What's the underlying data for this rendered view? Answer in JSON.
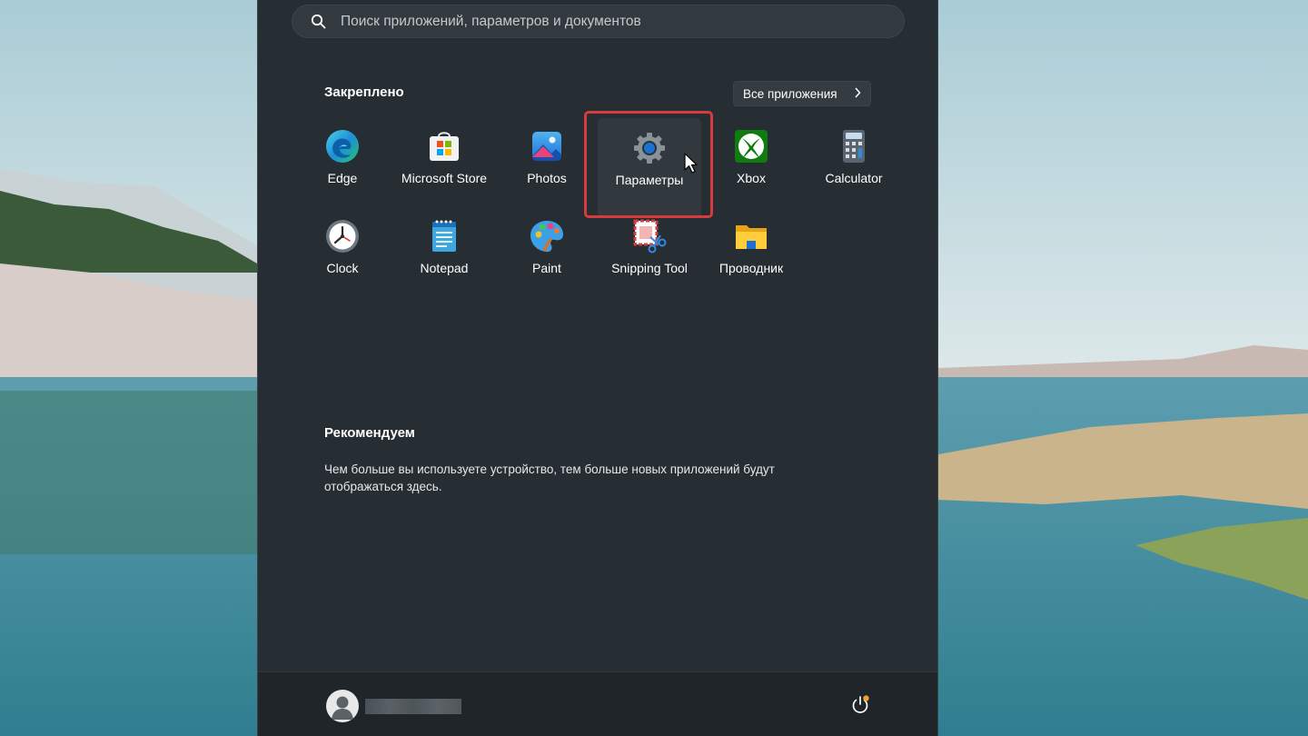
{
  "search": {
    "placeholder": "Поиск приложений, параметров и документов"
  },
  "pinned": {
    "title": "Закреплено",
    "all_apps_label": "Все приложения",
    "apps": [
      {
        "label": "Edge",
        "icon": "edge-icon"
      },
      {
        "label": "Microsoft Store",
        "icon": "microsoft-store-icon"
      },
      {
        "label": "Photos",
        "icon": "photos-icon"
      },
      {
        "label": "Параметры",
        "icon": "settings-gear-icon",
        "highlighted": true
      },
      {
        "label": "Xbox",
        "icon": "xbox-icon"
      },
      {
        "label": "Calculator",
        "icon": "calculator-icon"
      },
      {
        "label": "Clock",
        "icon": "clock-icon"
      },
      {
        "label": "Notepad",
        "icon": "notepad-icon"
      },
      {
        "label": "Paint",
        "icon": "paint-icon"
      },
      {
        "label": "Snipping Tool",
        "icon": "snipping-tool-icon"
      },
      {
        "label": "Проводник",
        "icon": "file-explorer-icon"
      }
    ]
  },
  "recommended": {
    "title": "Рекомендуем",
    "description": "Чем больше вы используете устройство, тем больше новых приложений будут отображаться здесь."
  },
  "footer": {
    "power_icon": "power-icon",
    "avatar_icon": "user-avatar-icon"
  },
  "colors": {
    "menu_background": "#262d33",
    "highlight_border": "#d83b3b",
    "update_dot": "#f0a030"
  }
}
